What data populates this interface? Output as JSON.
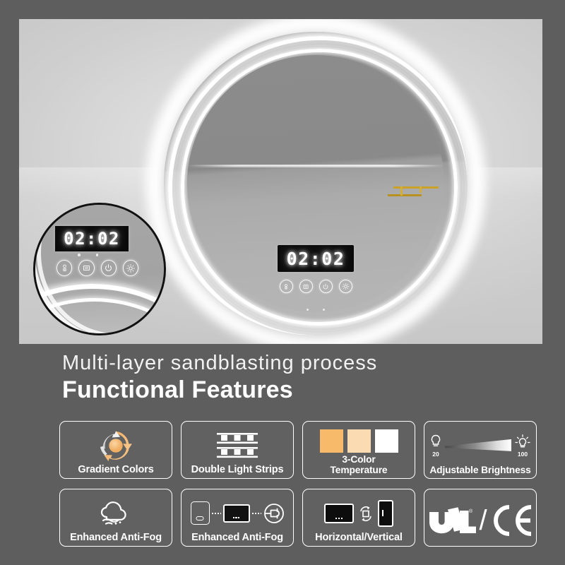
{
  "theme": {
    "page_bg": "#5e5e5e",
    "photo_bg": "#d4d4d4",
    "text_on_dark": "#ffffff",
    "led_white": "#ffffff",
    "gold_accent": "#c9a227",
    "display_bg": "#0b0b0b"
  },
  "hero": {
    "product": "round-backlit-led-bathroom-mirror",
    "mirror_display": {
      "clock_value": "02:02",
      "touch_buttons": [
        {
          "name": "anti-fog-button",
          "icon": "defog-icon"
        },
        {
          "name": "color-temperature-button",
          "icon": "light-panel-icon"
        },
        {
          "name": "power-button",
          "icon": "power-icon"
        },
        {
          "name": "brightness-button",
          "icon": "sun-icon"
        }
      ],
      "indicator_dots": 2
    },
    "magnifier": {
      "label": "control-panel-closeup",
      "clock_value": "02:02",
      "touch_buttons": [
        {
          "name": "anti-fog-button",
          "icon": "defog-icon"
        },
        {
          "name": "color-temperature-button",
          "icon": "light-panel-icon"
        },
        {
          "name": "power-button",
          "icon": "power-icon"
        },
        {
          "name": "brightness-button",
          "icon": "sun-icon"
        }
      ],
      "indicator_dots": 2
    }
  },
  "headings": {
    "subtitle": "Multi-layer sandblasting process",
    "title": "Functional Features"
  },
  "features": [
    {
      "id": "gradient-colors",
      "label": "Gradient Colors",
      "icon": "color-cycle-arrows-icon"
    },
    {
      "id": "double-light-strips",
      "label": "Double Light Strips",
      "icon": "light-strip-icon",
      "strip_count": 2,
      "leds_per_strip": 3
    },
    {
      "id": "3-color-temperature",
      "label": "3-Color\nTemperature",
      "icon": "color-swatches-icon",
      "swatches": [
        "#f7b96a",
        "#fbdcb2",
        "#ffffff"
      ]
    },
    {
      "id": "adjustable-brightness",
      "label": "Adjustable Brightness",
      "icon": "brightness-gradient-icon",
      "min_value": "20",
      "max_value": "100"
    },
    {
      "id": "enhanced-anti-fog",
      "label": "Enhanced Anti-Fog",
      "icon": "fog-cloud-icon"
    },
    {
      "id": "enhanced-anti-fog-wiring",
      "label": "Enhanced Anti-Fog",
      "icon": "switch-mirror-plug-icon"
    },
    {
      "id": "horizontal-vertical",
      "label": "Horizontal/Vertical",
      "icon": "rotate-orientation-icon"
    },
    {
      "id": "certifications",
      "label": "",
      "icon": "ul-ce-certification-icon",
      "marks": [
        "UL",
        "CE"
      ],
      "separator": "/"
    }
  ]
}
